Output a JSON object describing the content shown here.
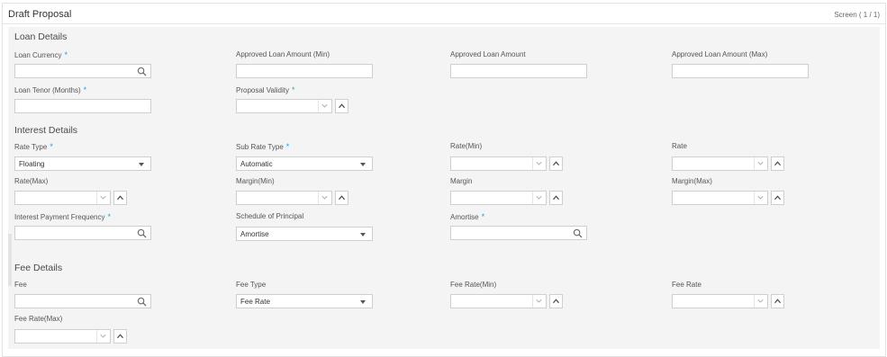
{
  "window": {
    "title": "Draft Proposal",
    "screen_indicator": "Screen ( 1 / 1)"
  },
  "loan_details": {
    "title": "Loan Details",
    "loan_currency": {
      "label": "Loan Currency",
      "required": "*",
      "value": ""
    },
    "approved_min": {
      "label": "Approved Loan Amount (Min)",
      "value": ""
    },
    "approved": {
      "label": "Approved Loan Amount",
      "value": ""
    },
    "approved_max": {
      "label": "Approved Loan Amount (Max)",
      "value": ""
    },
    "tenor": {
      "label": "Loan Tenor (Months)",
      "required": "*",
      "value": ""
    },
    "validity": {
      "label": "Proposal Validity",
      "required": "*",
      "value": ""
    }
  },
  "interest_details": {
    "title": "Interest Details",
    "rate_type": {
      "label": "Rate Type",
      "required": "*",
      "value": "Floating"
    },
    "sub_rate_type": {
      "label": "Sub Rate Type",
      "required": "*",
      "value": "Automatic"
    },
    "rate_min": {
      "label": "Rate(Min)",
      "value": ""
    },
    "rate": {
      "label": "Rate",
      "value": ""
    },
    "rate_max": {
      "label": "Rate(Max)",
      "value": ""
    },
    "margin_min": {
      "label": "Margin(Min)",
      "value": ""
    },
    "margin": {
      "label": "Margin",
      "value": ""
    },
    "margin_max": {
      "label": "Margin(Max)",
      "value": ""
    },
    "payment_frequency": {
      "label": "Interest Payment Frequency",
      "required": "*",
      "value": ""
    },
    "schedule_principal": {
      "label": "Schedule of Principal",
      "value": "Amortise"
    },
    "amortise": {
      "label": "Amortise",
      "required": "*",
      "value": ""
    }
  },
  "fee_details": {
    "title": "Fee Details",
    "fee": {
      "label": "Fee",
      "value": ""
    },
    "fee_type": {
      "label": "Fee Type",
      "value": "Fee Rate"
    },
    "fee_rate_min": {
      "label": "Fee Rate(Min)",
      "value": ""
    },
    "fee_rate": {
      "label": "Fee Rate",
      "value": ""
    },
    "fee_rate_max": {
      "label": "Fee Rate(Max)",
      "value": ""
    }
  },
  "icons": {
    "search": "search-icon",
    "dropdown": "chevron-down-icon",
    "increment": "chevron-up-icon",
    "decrement": "chevron-down-icon"
  },
  "colors": {
    "required_marker": "#2aa0d8",
    "panel_bg": "#f4f4f4",
    "border": "#cfcfcf"
  }
}
